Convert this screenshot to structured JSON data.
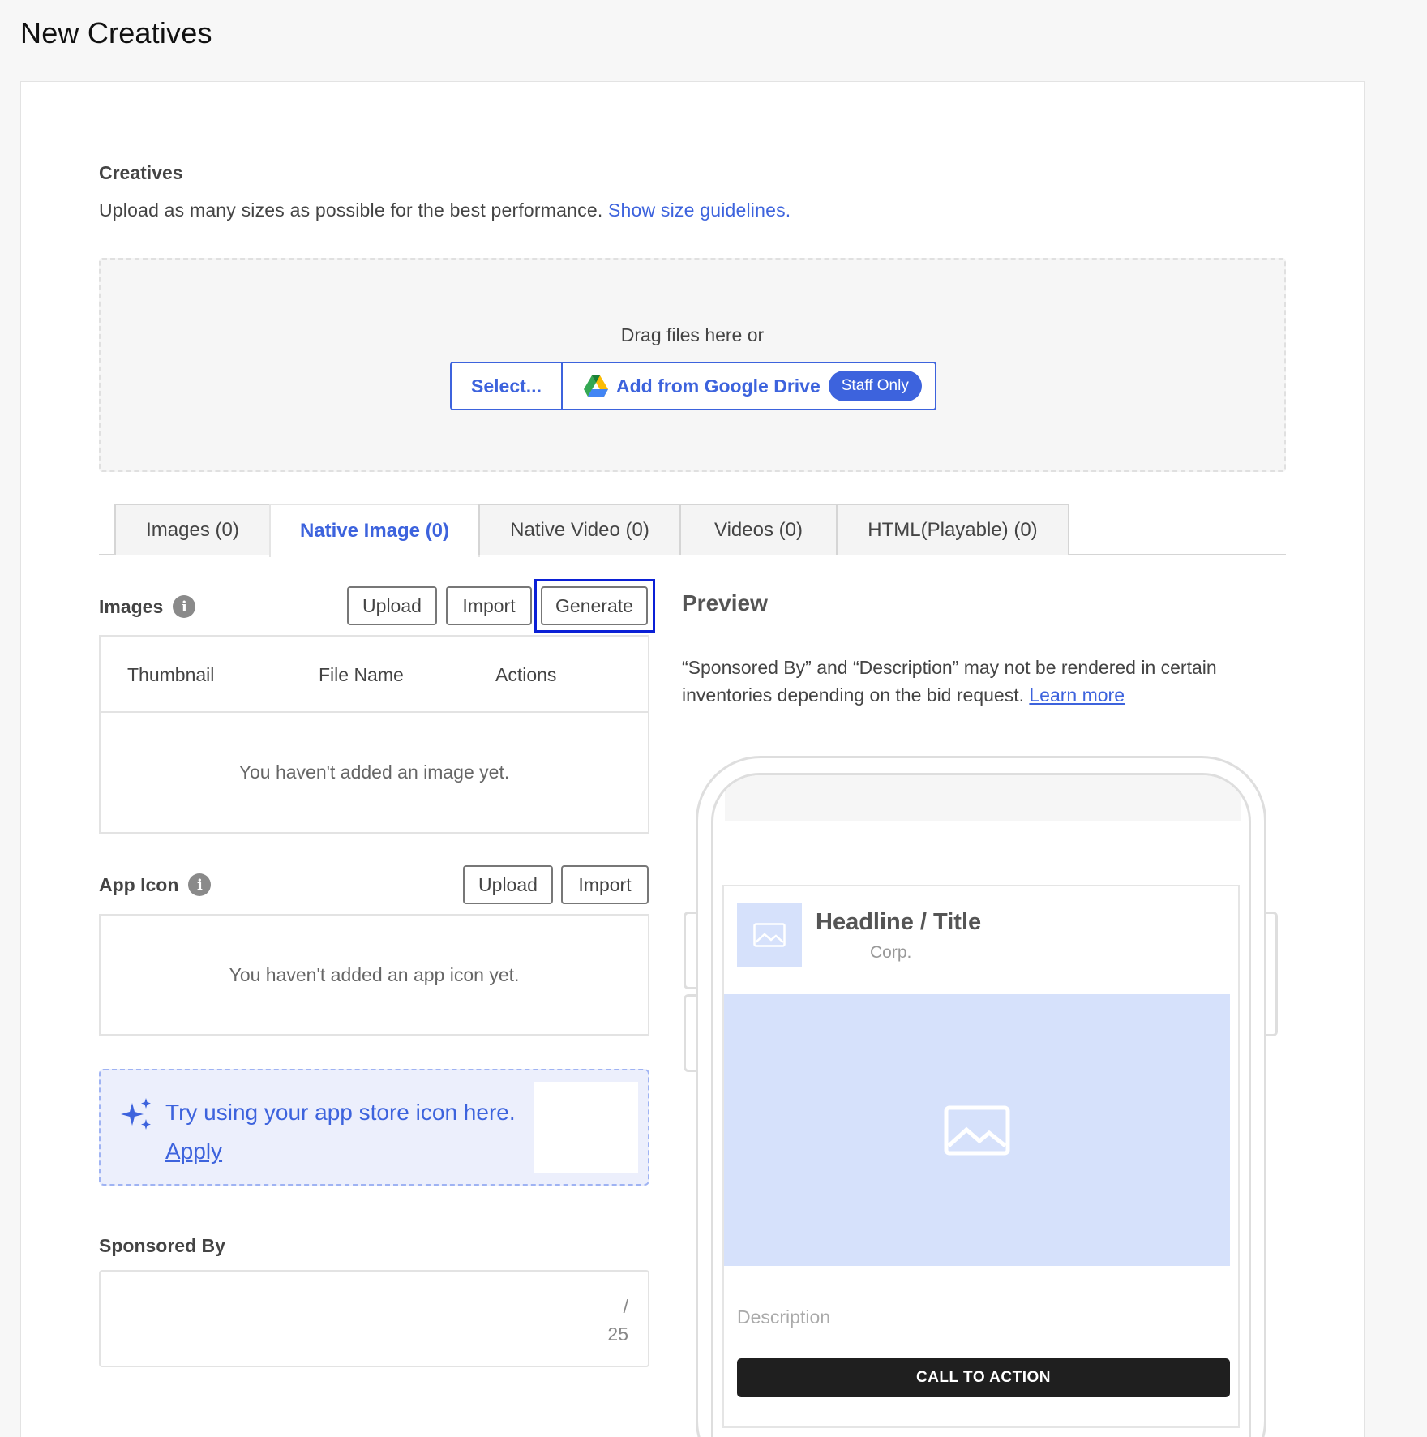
{
  "page": {
    "title": "New Creatives"
  },
  "creatives": {
    "title": "Creatives",
    "description": "Upload as many sizes as possible for the best performance. ",
    "guidelines_link": "Show size guidelines.",
    "drop_text": "Drag files here or",
    "select_label": "Select...",
    "gdrive_label": "Add from Google Drive",
    "staff_badge": "Staff Only"
  },
  "tabs": [
    {
      "label": "Images (0)",
      "active": false
    },
    {
      "label": "Native Image (0)",
      "active": true
    },
    {
      "label": "Native Video (0)",
      "active": false
    },
    {
      "label": "Videos (0)",
      "active": false
    },
    {
      "label": "HTML(Playable) (0)",
      "active": false
    }
  ],
  "images_section": {
    "label": "Images",
    "upload": "Upload",
    "import": "Import",
    "generate": "Generate",
    "columns": [
      "Thumbnail",
      "File Name",
      "Actions"
    ],
    "empty": "You haven't added an image yet."
  },
  "app_icon_section": {
    "label": "App Icon",
    "upload": "Upload",
    "import": "Import",
    "empty": "You haven't added an app icon yet.",
    "hint": "Try using your app store icon here.",
    "apply": "Apply"
  },
  "sponsored_by": {
    "label": "Sponsored By",
    "value": "",
    "counter_sep": "/",
    "max": "25"
  },
  "preview": {
    "title": "Preview",
    "note": "“Sponsored By” and “Description” may not be rendered in certain inventories depending on the bid request. ",
    "learn_more": "Learn more",
    "headline": "Headline / Title",
    "corp": "Corp.",
    "description": "Description",
    "cta": "CALL TO ACTION"
  },
  "colors": {
    "accent": "#3d63dd",
    "highlight": "#0b20d6",
    "placeholder_blue": "#d6e1fb",
    "cta_bg": "#1f1f1f"
  }
}
